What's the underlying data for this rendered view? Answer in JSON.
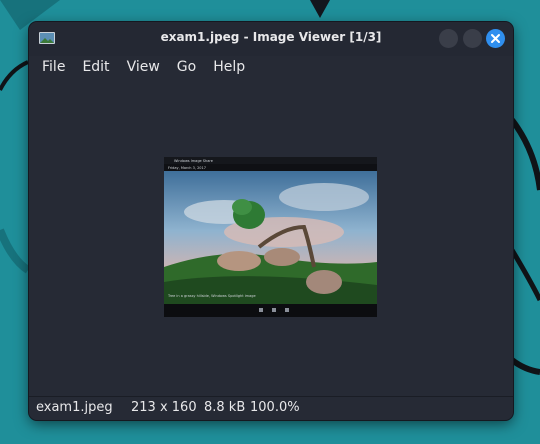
{
  "window": {
    "title": "exam1.jpeg - Image Viewer [1/3]"
  },
  "menubar": {
    "items": [
      "File",
      "Edit",
      "View",
      "Go",
      "Help"
    ]
  },
  "image": {
    "inner_title": "Windows Image Share",
    "inner_date": "Friday, March 3, 2017",
    "inner_caption": "Tree in a grassy hillside, Windows Spotlight image"
  },
  "statusbar": {
    "filename": "exam1.jpeg",
    "dimensions": "213 x 160",
    "filesize": "8.8 kB",
    "zoom": "100.0%"
  },
  "colors": {
    "desktop": "#1f8f9a",
    "window_bg": "#262a35",
    "accent": "#2f8fef"
  }
}
